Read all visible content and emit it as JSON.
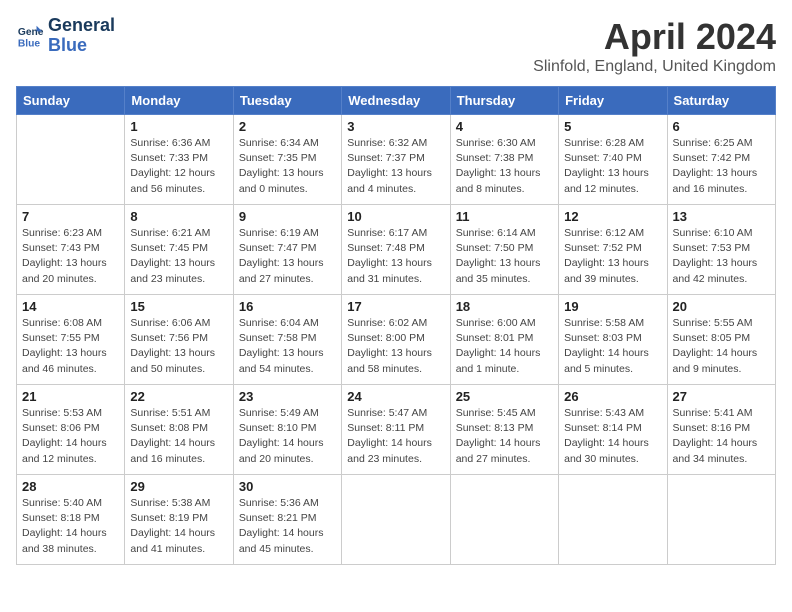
{
  "header": {
    "logo_line1": "General",
    "logo_line2": "Blue",
    "month": "April 2024",
    "location": "Slinfold, England, United Kingdom"
  },
  "weekdays": [
    "Sunday",
    "Monday",
    "Tuesday",
    "Wednesday",
    "Thursday",
    "Friday",
    "Saturday"
  ],
  "weeks": [
    [
      {
        "day": "",
        "sunrise": "",
        "sunset": "",
        "daylight": ""
      },
      {
        "day": "1",
        "sunrise": "Sunrise: 6:36 AM",
        "sunset": "Sunset: 7:33 PM",
        "daylight": "Daylight: 12 hours and 56 minutes."
      },
      {
        "day": "2",
        "sunrise": "Sunrise: 6:34 AM",
        "sunset": "Sunset: 7:35 PM",
        "daylight": "Daylight: 13 hours and 0 minutes."
      },
      {
        "day": "3",
        "sunrise": "Sunrise: 6:32 AM",
        "sunset": "Sunset: 7:37 PM",
        "daylight": "Daylight: 13 hours and 4 minutes."
      },
      {
        "day": "4",
        "sunrise": "Sunrise: 6:30 AM",
        "sunset": "Sunset: 7:38 PM",
        "daylight": "Daylight: 13 hours and 8 minutes."
      },
      {
        "day": "5",
        "sunrise": "Sunrise: 6:28 AM",
        "sunset": "Sunset: 7:40 PM",
        "daylight": "Daylight: 13 hours and 12 minutes."
      },
      {
        "day": "6",
        "sunrise": "Sunrise: 6:25 AM",
        "sunset": "Sunset: 7:42 PM",
        "daylight": "Daylight: 13 hours and 16 minutes."
      }
    ],
    [
      {
        "day": "7",
        "sunrise": "Sunrise: 6:23 AM",
        "sunset": "Sunset: 7:43 PM",
        "daylight": "Daylight: 13 hours and 20 minutes."
      },
      {
        "day": "8",
        "sunrise": "Sunrise: 6:21 AM",
        "sunset": "Sunset: 7:45 PM",
        "daylight": "Daylight: 13 hours and 23 minutes."
      },
      {
        "day": "9",
        "sunrise": "Sunrise: 6:19 AM",
        "sunset": "Sunset: 7:47 PM",
        "daylight": "Daylight: 13 hours and 27 minutes."
      },
      {
        "day": "10",
        "sunrise": "Sunrise: 6:17 AM",
        "sunset": "Sunset: 7:48 PM",
        "daylight": "Daylight: 13 hours and 31 minutes."
      },
      {
        "day": "11",
        "sunrise": "Sunrise: 6:14 AM",
        "sunset": "Sunset: 7:50 PM",
        "daylight": "Daylight: 13 hours and 35 minutes."
      },
      {
        "day": "12",
        "sunrise": "Sunrise: 6:12 AM",
        "sunset": "Sunset: 7:52 PM",
        "daylight": "Daylight: 13 hours and 39 minutes."
      },
      {
        "day": "13",
        "sunrise": "Sunrise: 6:10 AM",
        "sunset": "Sunset: 7:53 PM",
        "daylight": "Daylight: 13 hours and 42 minutes."
      }
    ],
    [
      {
        "day": "14",
        "sunrise": "Sunrise: 6:08 AM",
        "sunset": "Sunset: 7:55 PM",
        "daylight": "Daylight: 13 hours and 46 minutes."
      },
      {
        "day": "15",
        "sunrise": "Sunrise: 6:06 AM",
        "sunset": "Sunset: 7:56 PM",
        "daylight": "Daylight: 13 hours and 50 minutes."
      },
      {
        "day": "16",
        "sunrise": "Sunrise: 6:04 AM",
        "sunset": "Sunset: 7:58 PM",
        "daylight": "Daylight: 13 hours and 54 minutes."
      },
      {
        "day": "17",
        "sunrise": "Sunrise: 6:02 AM",
        "sunset": "Sunset: 8:00 PM",
        "daylight": "Daylight: 13 hours and 58 minutes."
      },
      {
        "day": "18",
        "sunrise": "Sunrise: 6:00 AM",
        "sunset": "Sunset: 8:01 PM",
        "daylight": "Daylight: 14 hours and 1 minute."
      },
      {
        "day": "19",
        "sunrise": "Sunrise: 5:58 AM",
        "sunset": "Sunset: 8:03 PM",
        "daylight": "Daylight: 14 hours and 5 minutes."
      },
      {
        "day": "20",
        "sunrise": "Sunrise: 5:55 AM",
        "sunset": "Sunset: 8:05 PM",
        "daylight": "Daylight: 14 hours and 9 minutes."
      }
    ],
    [
      {
        "day": "21",
        "sunrise": "Sunrise: 5:53 AM",
        "sunset": "Sunset: 8:06 PM",
        "daylight": "Daylight: 14 hours and 12 minutes."
      },
      {
        "day": "22",
        "sunrise": "Sunrise: 5:51 AM",
        "sunset": "Sunset: 8:08 PM",
        "daylight": "Daylight: 14 hours and 16 minutes."
      },
      {
        "day": "23",
        "sunrise": "Sunrise: 5:49 AM",
        "sunset": "Sunset: 8:10 PM",
        "daylight": "Daylight: 14 hours and 20 minutes."
      },
      {
        "day": "24",
        "sunrise": "Sunrise: 5:47 AM",
        "sunset": "Sunset: 8:11 PM",
        "daylight": "Daylight: 14 hours and 23 minutes."
      },
      {
        "day": "25",
        "sunrise": "Sunrise: 5:45 AM",
        "sunset": "Sunset: 8:13 PM",
        "daylight": "Daylight: 14 hours and 27 minutes."
      },
      {
        "day": "26",
        "sunrise": "Sunrise: 5:43 AM",
        "sunset": "Sunset: 8:14 PM",
        "daylight": "Daylight: 14 hours and 30 minutes."
      },
      {
        "day": "27",
        "sunrise": "Sunrise: 5:41 AM",
        "sunset": "Sunset: 8:16 PM",
        "daylight": "Daylight: 14 hours and 34 minutes."
      }
    ],
    [
      {
        "day": "28",
        "sunrise": "Sunrise: 5:40 AM",
        "sunset": "Sunset: 8:18 PM",
        "daylight": "Daylight: 14 hours and 38 minutes."
      },
      {
        "day": "29",
        "sunrise": "Sunrise: 5:38 AM",
        "sunset": "Sunset: 8:19 PM",
        "daylight": "Daylight: 14 hours and 41 minutes."
      },
      {
        "day": "30",
        "sunrise": "Sunrise: 5:36 AM",
        "sunset": "Sunset: 8:21 PM",
        "daylight": "Daylight: 14 hours and 45 minutes."
      },
      {
        "day": "",
        "sunrise": "",
        "sunset": "",
        "daylight": ""
      },
      {
        "day": "",
        "sunrise": "",
        "sunset": "",
        "daylight": ""
      },
      {
        "day": "",
        "sunrise": "",
        "sunset": "",
        "daylight": ""
      },
      {
        "day": "",
        "sunrise": "",
        "sunset": "",
        "daylight": ""
      }
    ]
  ]
}
